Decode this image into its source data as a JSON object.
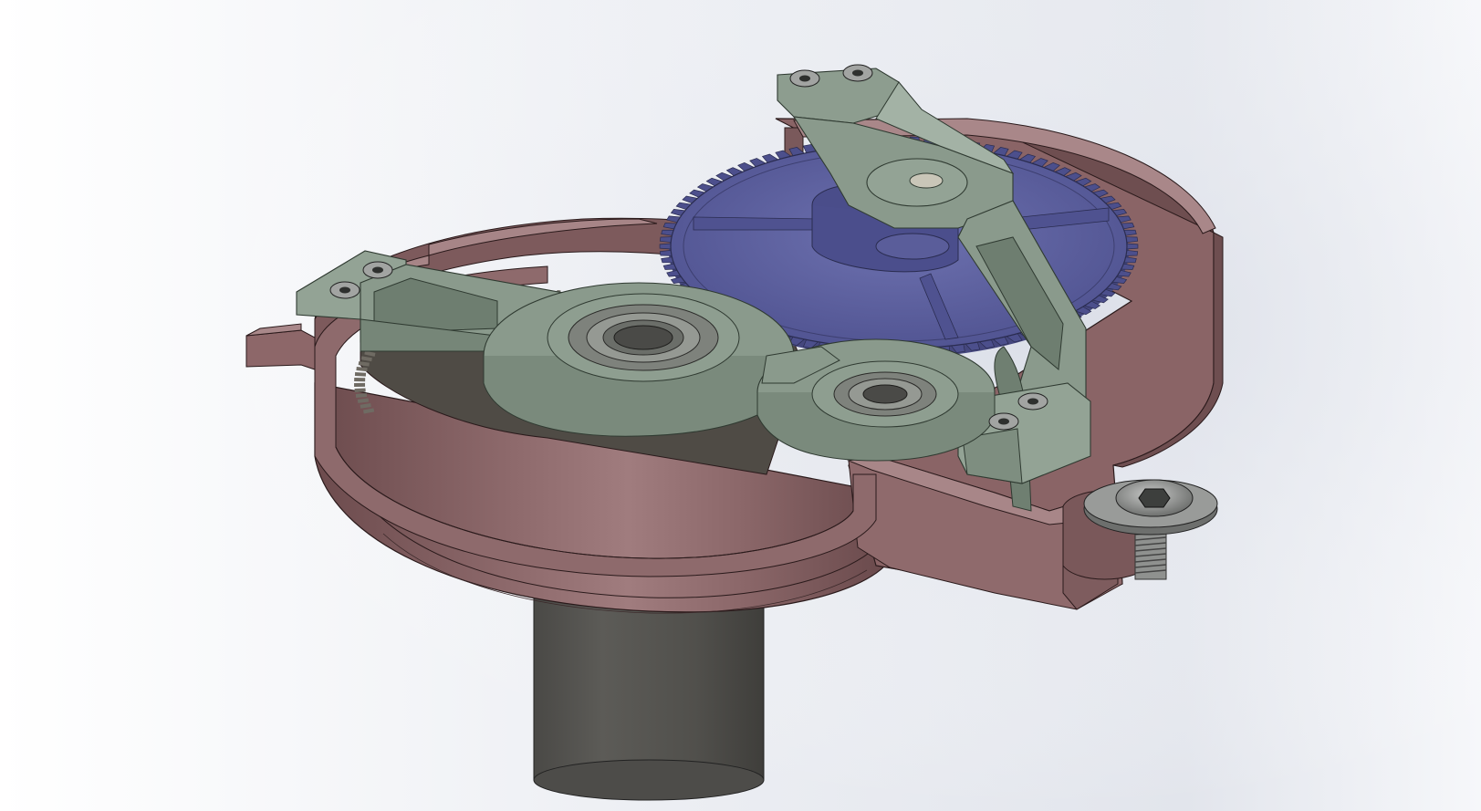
{
  "viewport": {
    "background_top": "#ffffff",
    "background_mid": "#dfe2ea",
    "background_bottom": "#ffffff"
  },
  "colors": {
    "housing": "#8a6466",
    "housing_light": "#9c7577",
    "housing_dark": "#5f4244",
    "gear_blue": "#5a5d9a",
    "gear_blue_light": "#6d70ab",
    "bracket_green": "#8a9a8c",
    "bracket_dark": "#5f6e61",
    "shaft": "#545350",
    "bearing": "#7a7d78",
    "screw": "#9a9c9a"
  },
  "parts": [
    "housing",
    "large-gear",
    "gear-bracket-arm",
    "bearing-plate",
    "motor-shaft",
    "mounting-screw"
  ]
}
